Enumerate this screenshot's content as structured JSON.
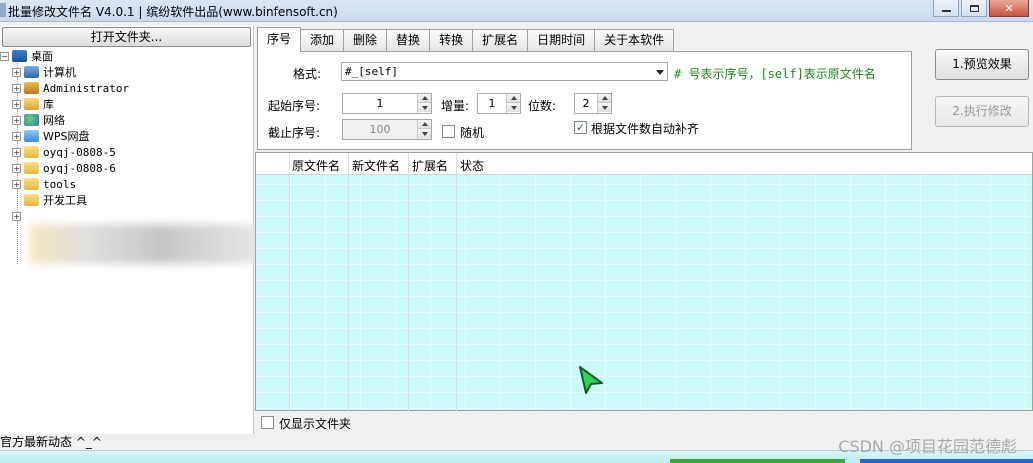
{
  "window": {
    "title": "批量修改文件名 V4.0.1 | 缤纷软件出品(www.binfensoft.cn)"
  },
  "left": {
    "open_folder_button": "打开文件夹...",
    "tree": [
      {
        "label": "桌面",
        "icon": "desktop-icon"
      },
      {
        "label": "计算机",
        "icon": "computer-icon"
      },
      {
        "label": "Administrator",
        "icon": "user-folder-icon"
      },
      {
        "label": "库",
        "icon": "library-icon"
      },
      {
        "label": "网络",
        "icon": "network-icon"
      },
      {
        "label": "WPS网盘",
        "icon": "cloud-icon"
      },
      {
        "label": "oyqj-0808-5",
        "icon": "folder-icon"
      },
      {
        "label": "oyqj-0808-6",
        "icon": "folder-icon"
      },
      {
        "label": "tools",
        "icon": "folder-icon"
      },
      {
        "label": "开发工具",
        "icon": "folder-icon"
      }
    ],
    "status": "官方最新动态 ^_^"
  },
  "tabs": [
    "序号",
    "添加",
    "删除",
    "替换",
    "转换",
    "扩展名",
    "日期时间",
    "关于本软件"
  ],
  "options": {
    "format_label": "格式:",
    "format_value": "#_[self]",
    "format_hint": "# 号表示序号，[self]表示原文件名",
    "start_label": "起始序号:",
    "start_value": "1",
    "increment_label": "增量:",
    "increment_value": "1",
    "digits_label": "位数:",
    "digits_value": "2",
    "end_label": "截止序号:",
    "end_value": "100",
    "random_label": "随机",
    "auto_pad_label": "根据文件数自动补齐",
    "auto_pad_checked": "✓"
  },
  "buttons": {
    "preview": "1.预览效果",
    "execute": "2.执行修改"
  },
  "list": {
    "columns": [
      "原文件名",
      "新文件名",
      "扩展名",
      "状态"
    ]
  },
  "bottom": {
    "only_folders_label": "仅显示文件夹"
  },
  "watermark": "CSDN @项目花园范德彪"
}
